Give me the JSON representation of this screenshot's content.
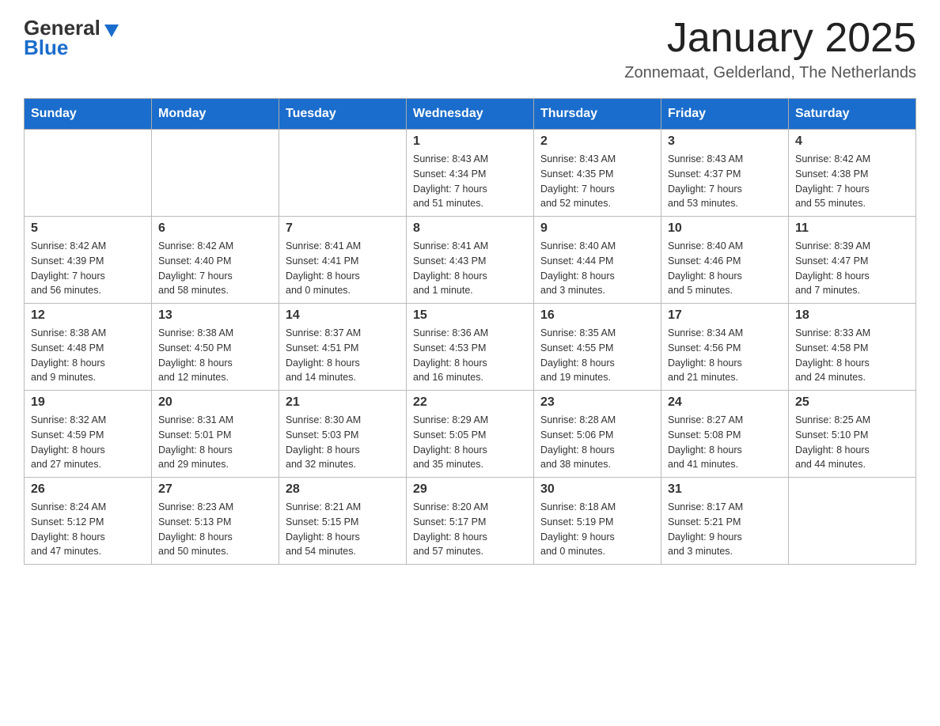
{
  "logo": {
    "general": "General",
    "blue": "Blue"
  },
  "title": "January 2025",
  "subtitle": "Zonnemaat, Gelderland, The Netherlands",
  "weekdays": [
    "Sunday",
    "Monday",
    "Tuesday",
    "Wednesday",
    "Thursday",
    "Friday",
    "Saturday"
  ],
  "weeks": [
    [
      {
        "day": "",
        "info": ""
      },
      {
        "day": "",
        "info": ""
      },
      {
        "day": "",
        "info": ""
      },
      {
        "day": "1",
        "info": "Sunrise: 8:43 AM\nSunset: 4:34 PM\nDaylight: 7 hours\nand 51 minutes."
      },
      {
        "day": "2",
        "info": "Sunrise: 8:43 AM\nSunset: 4:35 PM\nDaylight: 7 hours\nand 52 minutes."
      },
      {
        "day": "3",
        "info": "Sunrise: 8:43 AM\nSunset: 4:37 PM\nDaylight: 7 hours\nand 53 minutes."
      },
      {
        "day": "4",
        "info": "Sunrise: 8:42 AM\nSunset: 4:38 PM\nDaylight: 7 hours\nand 55 minutes."
      }
    ],
    [
      {
        "day": "5",
        "info": "Sunrise: 8:42 AM\nSunset: 4:39 PM\nDaylight: 7 hours\nand 56 minutes."
      },
      {
        "day": "6",
        "info": "Sunrise: 8:42 AM\nSunset: 4:40 PM\nDaylight: 7 hours\nand 58 minutes."
      },
      {
        "day": "7",
        "info": "Sunrise: 8:41 AM\nSunset: 4:41 PM\nDaylight: 8 hours\nand 0 minutes."
      },
      {
        "day": "8",
        "info": "Sunrise: 8:41 AM\nSunset: 4:43 PM\nDaylight: 8 hours\nand 1 minute."
      },
      {
        "day": "9",
        "info": "Sunrise: 8:40 AM\nSunset: 4:44 PM\nDaylight: 8 hours\nand 3 minutes."
      },
      {
        "day": "10",
        "info": "Sunrise: 8:40 AM\nSunset: 4:46 PM\nDaylight: 8 hours\nand 5 minutes."
      },
      {
        "day": "11",
        "info": "Sunrise: 8:39 AM\nSunset: 4:47 PM\nDaylight: 8 hours\nand 7 minutes."
      }
    ],
    [
      {
        "day": "12",
        "info": "Sunrise: 8:38 AM\nSunset: 4:48 PM\nDaylight: 8 hours\nand 9 minutes."
      },
      {
        "day": "13",
        "info": "Sunrise: 8:38 AM\nSunset: 4:50 PM\nDaylight: 8 hours\nand 12 minutes."
      },
      {
        "day": "14",
        "info": "Sunrise: 8:37 AM\nSunset: 4:51 PM\nDaylight: 8 hours\nand 14 minutes."
      },
      {
        "day": "15",
        "info": "Sunrise: 8:36 AM\nSunset: 4:53 PM\nDaylight: 8 hours\nand 16 minutes."
      },
      {
        "day": "16",
        "info": "Sunrise: 8:35 AM\nSunset: 4:55 PM\nDaylight: 8 hours\nand 19 minutes."
      },
      {
        "day": "17",
        "info": "Sunrise: 8:34 AM\nSunset: 4:56 PM\nDaylight: 8 hours\nand 21 minutes."
      },
      {
        "day": "18",
        "info": "Sunrise: 8:33 AM\nSunset: 4:58 PM\nDaylight: 8 hours\nand 24 minutes."
      }
    ],
    [
      {
        "day": "19",
        "info": "Sunrise: 8:32 AM\nSunset: 4:59 PM\nDaylight: 8 hours\nand 27 minutes."
      },
      {
        "day": "20",
        "info": "Sunrise: 8:31 AM\nSunset: 5:01 PM\nDaylight: 8 hours\nand 29 minutes."
      },
      {
        "day": "21",
        "info": "Sunrise: 8:30 AM\nSunset: 5:03 PM\nDaylight: 8 hours\nand 32 minutes."
      },
      {
        "day": "22",
        "info": "Sunrise: 8:29 AM\nSunset: 5:05 PM\nDaylight: 8 hours\nand 35 minutes."
      },
      {
        "day": "23",
        "info": "Sunrise: 8:28 AM\nSunset: 5:06 PM\nDaylight: 8 hours\nand 38 minutes."
      },
      {
        "day": "24",
        "info": "Sunrise: 8:27 AM\nSunset: 5:08 PM\nDaylight: 8 hours\nand 41 minutes."
      },
      {
        "day": "25",
        "info": "Sunrise: 8:25 AM\nSunset: 5:10 PM\nDaylight: 8 hours\nand 44 minutes."
      }
    ],
    [
      {
        "day": "26",
        "info": "Sunrise: 8:24 AM\nSunset: 5:12 PM\nDaylight: 8 hours\nand 47 minutes."
      },
      {
        "day": "27",
        "info": "Sunrise: 8:23 AM\nSunset: 5:13 PM\nDaylight: 8 hours\nand 50 minutes."
      },
      {
        "day": "28",
        "info": "Sunrise: 8:21 AM\nSunset: 5:15 PM\nDaylight: 8 hours\nand 54 minutes."
      },
      {
        "day": "29",
        "info": "Sunrise: 8:20 AM\nSunset: 5:17 PM\nDaylight: 8 hours\nand 57 minutes."
      },
      {
        "day": "30",
        "info": "Sunrise: 8:18 AM\nSunset: 5:19 PM\nDaylight: 9 hours\nand 0 minutes."
      },
      {
        "day": "31",
        "info": "Sunrise: 8:17 AM\nSunset: 5:21 PM\nDaylight: 9 hours\nand 3 minutes."
      },
      {
        "day": "",
        "info": ""
      }
    ]
  ]
}
